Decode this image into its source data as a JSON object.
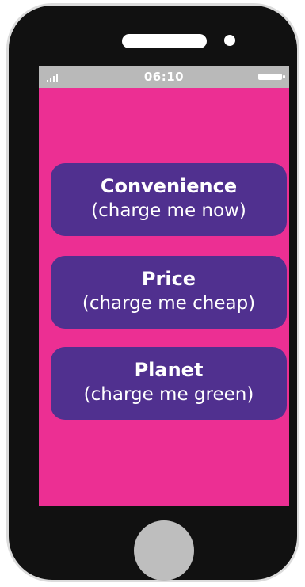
{
  "status_bar": {
    "time": "06:10"
  },
  "options": [
    {
      "title": "Convenience",
      "subtitle": "(charge me now)"
    },
    {
      "title": "Price",
      "subtitle": "(charge me cheap)"
    },
    {
      "title": "Planet",
      "subtitle": "(charge me green)"
    }
  ],
  "colors": {
    "phone_body": "#111111",
    "screen_pink": "#ec2f93",
    "screen_edge_pink": "#e21a7c",
    "button_purple": "#50308f",
    "status_bar_gray": "#b9b9b9",
    "home_button_gray": "#bebebe"
  },
  "icons": {
    "signal": "signal-icon",
    "battery": "battery-icon"
  }
}
